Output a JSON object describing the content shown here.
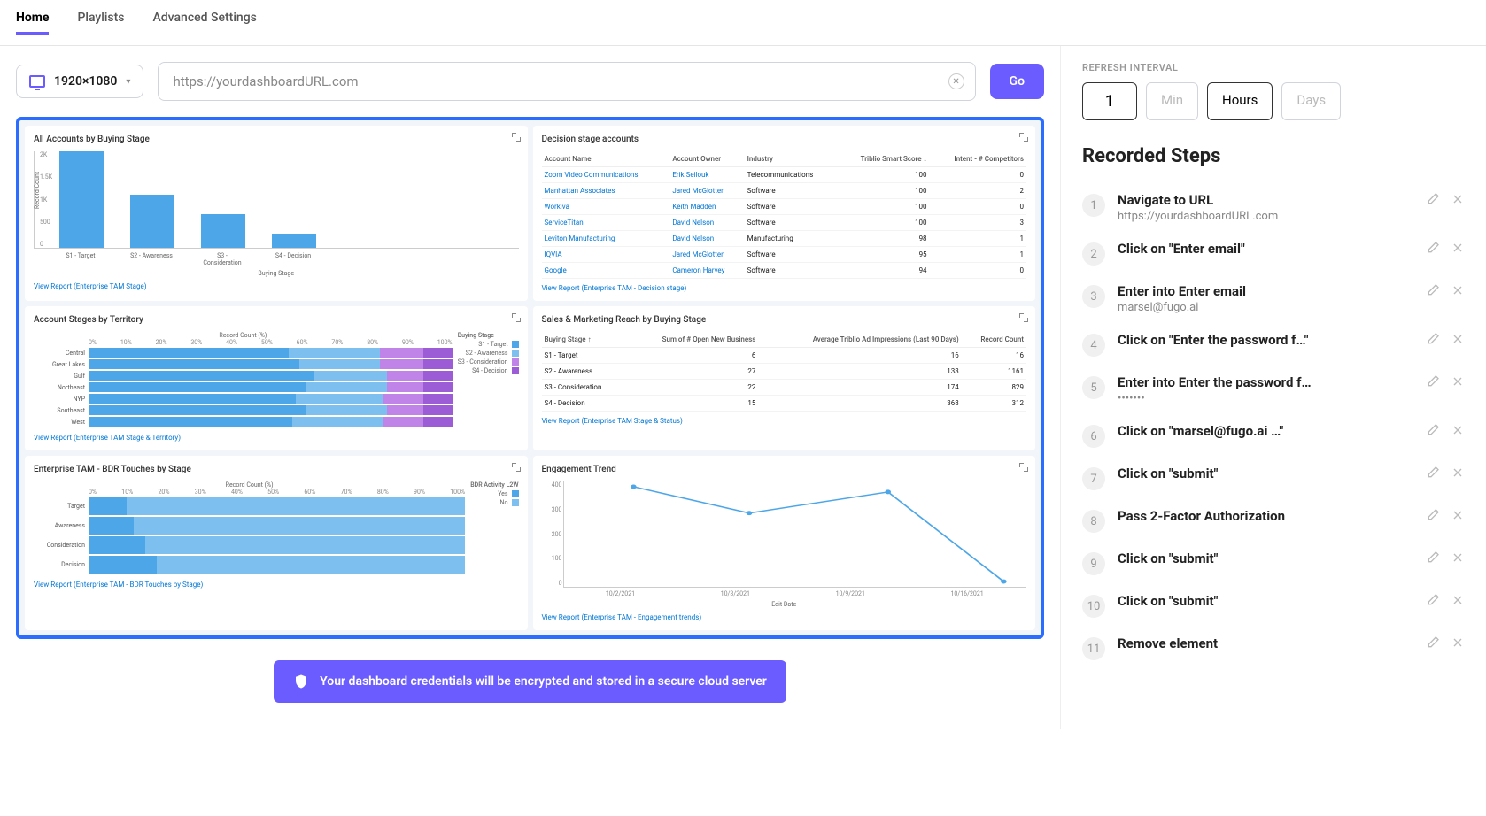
{
  "nav": {
    "home": "Home",
    "playlists": "Playlists",
    "advanced": "Advanced Settings"
  },
  "resolution": "1920×1080",
  "url": "https://yourdashboardURL.com",
  "go": "Go",
  "refresh": {
    "label": "REFRESH INTERVAL",
    "value": "1",
    "min": "Min",
    "hours": "Hours",
    "days": "Days"
  },
  "recorded_title": "Recorded Steps",
  "steps": [
    {
      "n": "1",
      "title": "Navigate to URL",
      "sub": "https://yourdashboardURL.com"
    },
    {
      "n": "2",
      "title": "Click on \"Enter email\""
    },
    {
      "n": "3",
      "title": "Enter into Enter email",
      "sub": "marsel@fugo.ai"
    },
    {
      "n": "4",
      "title": "Click on \"Enter the password f…\""
    },
    {
      "n": "5",
      "title": "Enter into Enter the password f…",
      "sub": "•••••••"
    },
    {
      "n": "6",
      "title": "Click on \"marsel@fugo.ai …\""
    },
    {
      "n": "7",
      "title": "Click on \"submit\""
    },
    {
      "n": "8",
      "title": "Pass 2-Factor Authorization"
    },
    {
      "n": "9",
      "title": "Click on \"submit\""
    },
    {
      "n": "10",
      "title": "Click on \"submit\""
    },
    {
      "n": "11",
      "title": "Remove element"
    }
  ],
  "banner": "Your dashboard credentials will be encrypted and stored in a secure cloud server",
  "cards": {
    "c1": {
      "title": "All Accounts by Buying Stage",
      "report": "View Report (Enterprise TAM Stage)",
      "xaxis": "Buying Stage",
      "yaxis": "Record Count",
      "cats": [
        "S1 - Target",
        "S2 - Awareness",
        "S3 - Consideration",
        "S4 - Decision"
      ]
    },
    "c2": {
      "title": "Decision stage accounts",
      "report": "View Report (Enterprise TAM - Decision stage)",
      "cols": [
        "Account Name",
        "Account Owner",
        "Industry",
        "Triblio Smart Score  ↓",
        "Intent - # Competitors"
      ],
      "rows": [
        [
          "Zoom Video Communications",
          "Erik Seilouk",
          "Telecommunications",
          "100",
          "0"
        ],
        [
          "Manhattan Associates",
          "Jared McGlotten",
          "Software",
          "100",
          "2"
        ],
        [
          "Workiva",
          "Keith Madden",
          "Software",
          "100",
          "0"
        ],
        [
          "ServiceTitan",
          "David Nelson",
          "Software",
          "100",
          "3"
        ],
        [
          "Leviton Manufacturing",
          "David Nelson",
          "Manufacturing",
          "98",
          "1"
        ],
        [
          "IQVIA",
          "Jared McGlotten",
          "Software",
          "95",
          "1"
        ],
        [
          "Google",
          "Cameron Harvey",
          "Software",
          "94",
          "0"
        ]
      ]
    },
    "c3": {
      "title": "Account Stages by Territory",
      "report": "View Report (Enterprise TAM Stage & Territory)",
      "axis_title": "Record Count (%)",
      "legend_title": "Buying Stage",
      "territories": [
        "Central",
        "Great Lakes",
        "Gulf",
        "Northeast",
        "NYP",
        "Southeast",
        "West"
      ],
      "legend": [
        "S1 - Target",
        "S2 - Awareness",
        "S3 - Consideration",
        "S4 - Decision"
      ]
    },
    "c4": {
      "title": "Sales & Marketing Reach by Buying Stage",
      "report": "View Report (Enterprise TAM Stage & Status)",
      "cols": [
        "Buying Stage  ↑",
        "Sum of # Open New Business",
        "Average Triblio Ad Impressions (Last 90 Days)",
        "Record Count"
      ],
      "rows": [
        [
          "S1 - Target",
          "6",
          "16",
          "16"
        ],
        [
          "S2 - Awareness",
          "27",
          "133",
          "1161"
        ],
        [
          "S3 - Consideration",
          "22",
          "174",
          "829"
        ],
        [
          "S4 - Decision",
          "15",
          "368",
          "312"
        ]
      ]
    },
    "c5": {
      "title": "Enterprise TAM - BDR Touches by Stage",
      "report": "View Report (Enterprise TAM - BDR Touches by Stage)",
      "axis_title": "Record Count (%)",
      "legend_title": "BDR Activity L2W",
      "stages": [
        "Target",
        "Awareness",
        "Consideration",
        "Decision"
      ],
      "legend": [
        "Yes",
        "No"
      ]
    },
    "c6": {
      "title": "Engagement Trend",
      "report": "View Report (Enterprise TAM - Engagement trends)",
      "yaxis": "Record Count",
      "xaxis": "Edit Date",
      "xticks": [
        "10/2/2021",
        "10/3/2021",
        "10/9/2021",
        "10/16/2021"
      ]
    }
  },
  "chart_data": [
    {
      "type": "bar",
      "title": "All Accounts by Buying Stage",
      "xlabel": "Buying Stage",
      "ylabel": "Record Count",
      "categories": [
        "S1 - Target",
        "S2 - Awareness",
        "S3 - Consideration",
        "S4 - Decision"
      ],
      "values": [
        2000,
        1100,
        700,
        300
      ],
      "ylim": [
        0,
        2000
      ],
      "yticks": [
        "2K",
        "1.5K",
        "1K",
        "500",
        "0"
      ]
    },
    {
      "type": "table",
      "title": "Decision stage accounts",
      "columns": [
        "Account Name",
        "Account Owner",
        "Industry",
        "Triblio Smart Score",
        "Intent - # Competitors"
      ],
      "rows": [
        [
          "Zoom Video Communications",
          "Erik Seilouk",
          "Telecommunications",
          100,
          0
        ],
        [
          "Manhattan Associates",
          "Jared McGlotten",
          "Software",
          100,
          2
        ],
        [
          "Workiva",
          "Keith Madden",
          "Software",
          100,
          0
        ],
        [
          "ServiceTitan",
          "David Nelson",
          "Software",
          100,
          3
        ],
        [
          "Leviton Manufacturing",
          "David Nelson",
          "Manufacturing",
          98,
          1
        ],
        [
          "IQVIA",
          "Jared McGlotten",
          "Software",
          95,
          1
        ],
        [
          "Google",
          "Cameron Harvey",
          "Software",
          94,
          0
        ]
      ]
    },
    {
      "type": "bar_stacked_horizontal",
      "title": "Account Stages by Territory",
      "xlabel": "Record Count (%)",
      "categories": [
        "Central",
        "Great Lakes",
        "Gulf",
        "Northeast",
        "NYP",
        "Southeast",
        "West"
      ],
      "series": [
        {
          "name": "S1 - Target",
          "values": [
            55,
            58,
            62,
            60,
            57,
            60,
            56
          ]
        },
        {
          "name": "S2 - Awareness",
          "values": [
            25,
            22,
            20,
            22,
            24,
            22,
            25
          ]
        },
        {
          "name": "S3 - Consideration",
          "values": [
            12,
            12,
            10,
            10,
            11,
            10,
            11
          ]
        },
        {
          "name": "S4 - Decision",
          "values": [
            8,
            8,
            8,
            8,
            8,
            8,
            8
          ]
        }
      ],
      "xlim": [
        0,
        100
      ]
    },
    {
      "type": "table",
      "title": "Sales & Marketing Reach by Buying Stage",
      "columns": [
        "Buying Stage",
        "Sum of # Open New Business",
        "Average Triblio Ad Impressions (Last 90 Days)",
        "Record Count"
      ],
      "rows": [
        [
          "S1 - Target",
          6,
          16,
          16
        ],
        [
          "S2 - Awareness",
          27,
          133,
          1161
        ],
        [
          "S3 - Consideration",
          22,
          174,
          829
        ],
        [
          "S4 - Decision",
          15,
          368,
          312
        ]
      ]
    },
    {
      "type": "bar_stacked_horizontal",
      "title": "Enterprise TAM - BDR Touches by Stage",
      "xlabel": "Record Count (%)",
      "categories": [
        "Target",
        "Awareness",
        "Consideration",
        "Decision"
      ],
      "series": [
        {
          "name": "Yes",
          "values": [
            10,
            12,
            15,
            18
          ]
        },
        {
          "name": "No",
          "values": [
            90,
            88,
            85,
            82
          ]
        }
      ],
      "xlim": [
        0,
        100
      ]
    },
    {
      "type": "line",
      "title": "Engagement Trend",
      "xlabel": "Edit Date",
      "ylabel": "Record Count",
      "x": [
        "10/2/2021",
        "10/3/2021",
        "10/9/2021",
        "10/16/2021"
      ],
      "values": [
        380,
        280,
        360,
        20
      ],
      "ylim": [
        0,
        400
      ],
      "yticks": [
        "400",
        "300",
        "200",
        "100",
        "0"
      ]
    }
  ]
}
